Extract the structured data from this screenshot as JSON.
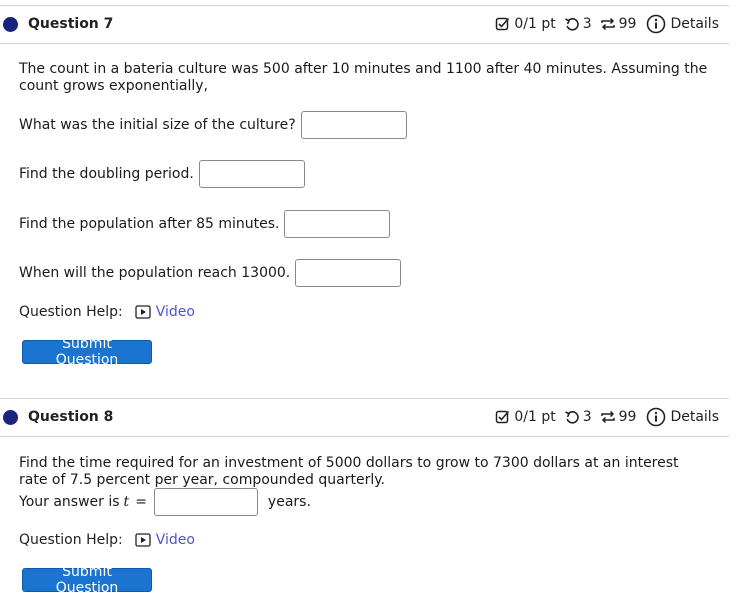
{
  "q7": {
    "title": "Question 7",
    "score": "0/1 pt",
    "retries": "3",
    "attempts": "99",
    "details": "Details",
    "prompt": "The count in a bateria culture was 500 after 10 minutes and 1100 after 40 minutes. Assuming the count grows exponentially,",
    "parts": [
      "What was the initial size of the culture?",
      "Find the doubling period.",
      "Find the population after 85 minutes.",
      "When will the population reach 13000."
    ],
    "help_label": "Question Help:",
    "video_label": "Video",
    "submit_label": "Submit Question"
  },
  "q8": {
    "title": "Question 8",
    "score": "0/1 pt",
    "retries": "3",
    "attempts": "99",
    "details": "Details",
    "prompt": "Find the time required for an investment of 5000 dollars to grow to 7300 dollars at an interest rate of 7.5 percent per year, compounded quarterly.",
    "answer_prefix": "Your answer is",
    "answer_var": "t",
    "answer_eq": "=",
    "answer_units": "years.",
    "help_label": "Question Help:",
    "video_label": "Video",
    "submit_label": "Submit Question"
  },
  "colors": {
    "accent_dot": "#1a237e",
    "submit_bg": "#1b75d0",
    "link": "#4a56d0"
  },
  "icons": {
    "score": "checkbox-edit-icon",
    "retries": "undo-arrow-icon",
    "attempts": "repeat-arrows-icon",
    "details": "info-circle-icon",
    "video": "play-box-icon"
  }
}
